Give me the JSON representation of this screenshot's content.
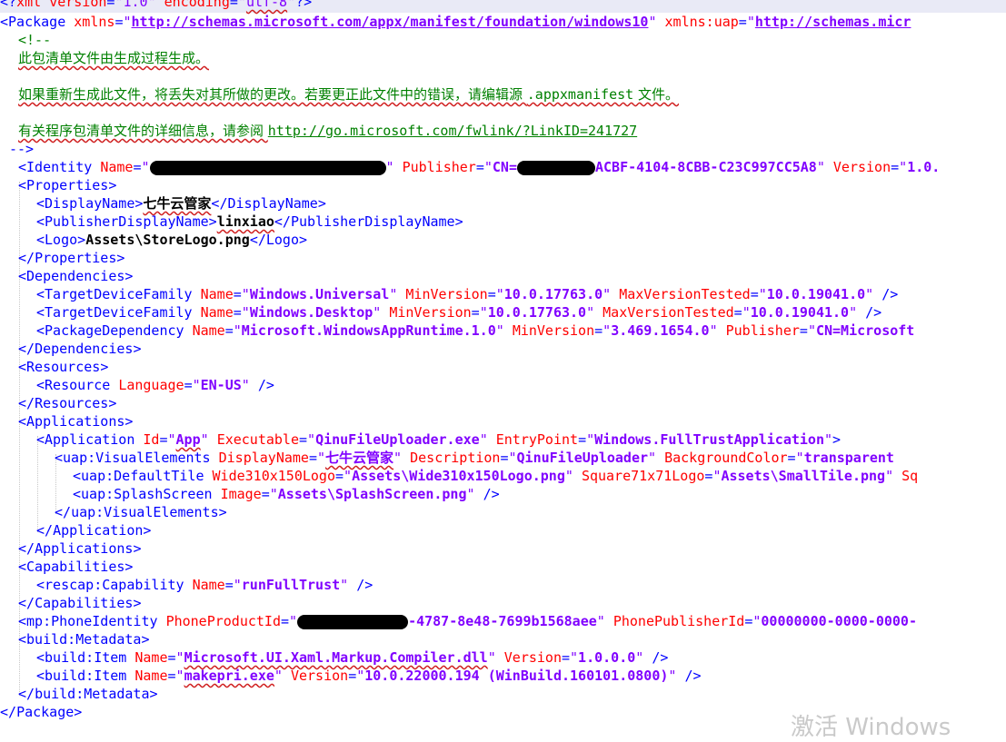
{
  "xml_decl": {
    "name": "xml",
    "version_attr": "version",
    "version": "1.0",
    "encoding_attr": "encoding",
    "encoding": "utf-8"
  },
  "package": {
    "tag": "Package",
    "xmlns_attr": "xmlns",
    "xmlns": "http://schemas.microsoft.com/appx/manifest/foundation/windows10",
    "xmlns_uap_attr": "xmlns:uap",
    "xmlns_uap": "http://schemas.micr"
  },
  "comment": {
    "open": "<!--",
    "line1": "此包清单文件由生成过程生成。",
    "line2a": "如果重新生成此文件，将丢失对其所做的更改。若要更正此文件中的错误，请编辑源 ",
    "line2b": ".appxmanifest",
    "line2c": " 文件。",
    "line3a": "有关程序包清单文件的详细信息，请参阅 ",
    "line3_link": "http://go.microsoft.com/fwlink/?LinkID=241727",
    "close": "-->"
  },
  "identity": {
    "tag": "Identity",
    "name_attr": "Name",
    "name_tail": "\"",
    "publisher_attr": "Publisher",
    "publisher_head": "CN=",
    "publisher_tail": "ACBF-4104-8CBB-C23C997CC5A8",
    "version_attr": "Version",
    "version": "1.0."
  },
  "properties": {
    "tag": "Properties",
    "display_name_tag": "DisplayName",
    "display_name": "七牛云管家",
    "publisher_display_tag": "PublisherDisplayName",
    "publisher_display": "linxiao",
    "logo_tag": "Logo",
    "logo": "Assets\\StoreLogo.png"
  },
  "dependencies": {
    "tag": "Dependencies",
    "tdf_tag": "TargetDeviceFamily",
    "name_attr": "Name",
    "minv_attr": "MinVersion",
    "maxv_attr": "MaxVersionTested",
    "tdf1_name": "Windows.Universal",
    "tdf1_min": "10.0.17763.0",
    "tdf1_max": "10.0.19041.0",
    "tdf2_name": "Windows.Desktop",
    "tdf2_min": "10.0.17763.0",
    "tdf2_max": "10.0.19041.0",
    "pkg_tag": "PackageDependency",
    "pkg_name": "Microsoft.WindowsAppRuntime.1.0",
    "pkg_min": "3.469.1654.0",
    "pkg_pub_attr": "Publisher",
    "pkg_pub": "CN=Microsoft"
  },
  "resources": {
    "tag": "Resources",
    "res_tag": "Resource",
    "lang_attr": "Language",
    "lang": "EN-US"
  },
  "applications": {
    "tag": "Applications",
    "app_tag": "Application",
    "id_attr": "Id",
    "id": "App",
    "exe_attr": "Executable",
    "exe": "QinuFileUploader.exe",
    "entry_attr": "EntryPoint",
    "entry": "Windows.FullTrustApplication",
    "ve_tag": "uap:VisualElements",
    "ve_dn_attr": "DisplayName",
    "ve_dn": "七牛云管家",
    "ve_desc_attr": "Description",
    "ve_desc": "QinuFileUploader",
    "ve_bg_attr": "BackgroundColor",
    "ve_bg": "transparent",
    "dt_tag": "uap:DefaultTile",
    "dt_wide_attr": "Wide310x150Logo",
    "dt_wide": "Assets\\Wide310x150Logo.png",
    "dt_sq_attr": "Square71x71Logo",
    "dt_sq": "Assets\\SmallTile.png",
    "dt_more": "Sq",
    "ss_tag": "uap:SplashScreen",
    "ss_img_attr": "Image",
    "ss_img": "Assets\\SplashScreen.png"
  },
  "capabilities": {
    "tag": "Capabilities",
    "cap_tag": "rescap:Capability",
    "name_attr": "Name",
    "cap": "runFullTrust"
  },
  "phone": {
    "tag": "mp:PhoneIdentity",
    "prod_attr": "PhoneProductId",
    "prod_tail": "-4787-8e48-7699b1568aee",
    "pub_attr": "PhonePublisherId",
    "pub": "00000000-0000-0000-"
  },
  "build": {
    "tag": "build:Metadata",
    "item_tag": "build:Item",
    "name_attr": "Name",
    "ver_attr": "Version",
    "item1_name": "Microsoft.UI.Xaml.Markup.Compiler.dll",
    "item1_ver": "1.0.0.0",
    "item2_name": "makepri.exe",
    "item2_ver": "10.0.22000.194 (WinBuild.160101.0800)"
  },
  "watermark": "激活 Windows"
}
